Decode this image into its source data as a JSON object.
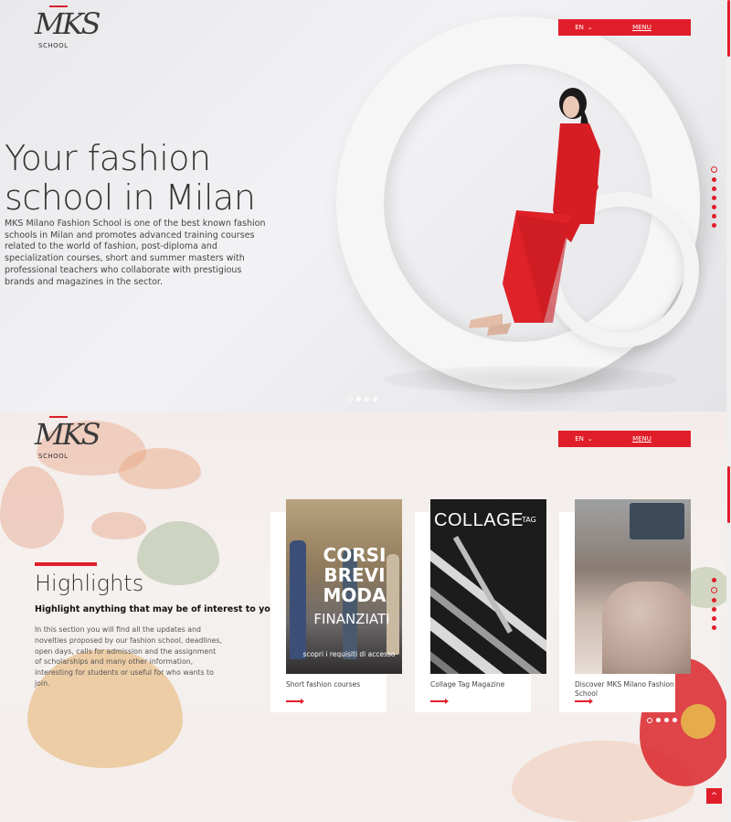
{
  "logo": {
    "mark": "MKS",
    "school": "SCHOOL"
  },
  "nav": {
    "lang": "EN",
    "lang_arrow": "⌄",
    "menu": "MENU"
  },
  "hero": {
    "title_line1": "Your fashion",
    "title_line2": "school in Milan",
    "description": "MKS Milano Fashion School is one of the best known fashion schools in Milan and promotes advanced training courses related to the world of fashion, post-diploma and specialization courses, short and summer masters with professional teachers who collaborate with prestigious brands and magazines in the sector."
  },
  "highlights": {
    "title": "Highlights",
    "subtitle": "Highlight anything that may be of interest to you",
    "description": "In this section you will find all the updates and novelties proposed by our fashion school, deadlines, open days, calls for admission and the assignment of scholarships and many other information, interesting for students or useful for who wants to join.",
    "cards": [
      {
        "caption": "Short fashion courses",
        "image_text": {
          "line1": "CORSI",
          "line2": "BREVI",
          "line3": "MODA",
          "line4": "FINANZIATI",
          "link": "scopri i requisiti di accesso"
        }
      },
      {
        "caption": "Collage Tag Magazine",
        "image_text": {
          "title": "COLLAGE",
          "tag": "TAG"
        }
      },
      {
        "caption": "Discover MKS Milano Fashion School"
      }
    ]
  },
  "icons": {
    "back_to_top": "^",
    "arrow": "arrow-right-icon"
  },
  "colors": {
    "accent": "#e01e2a"
  }
}
